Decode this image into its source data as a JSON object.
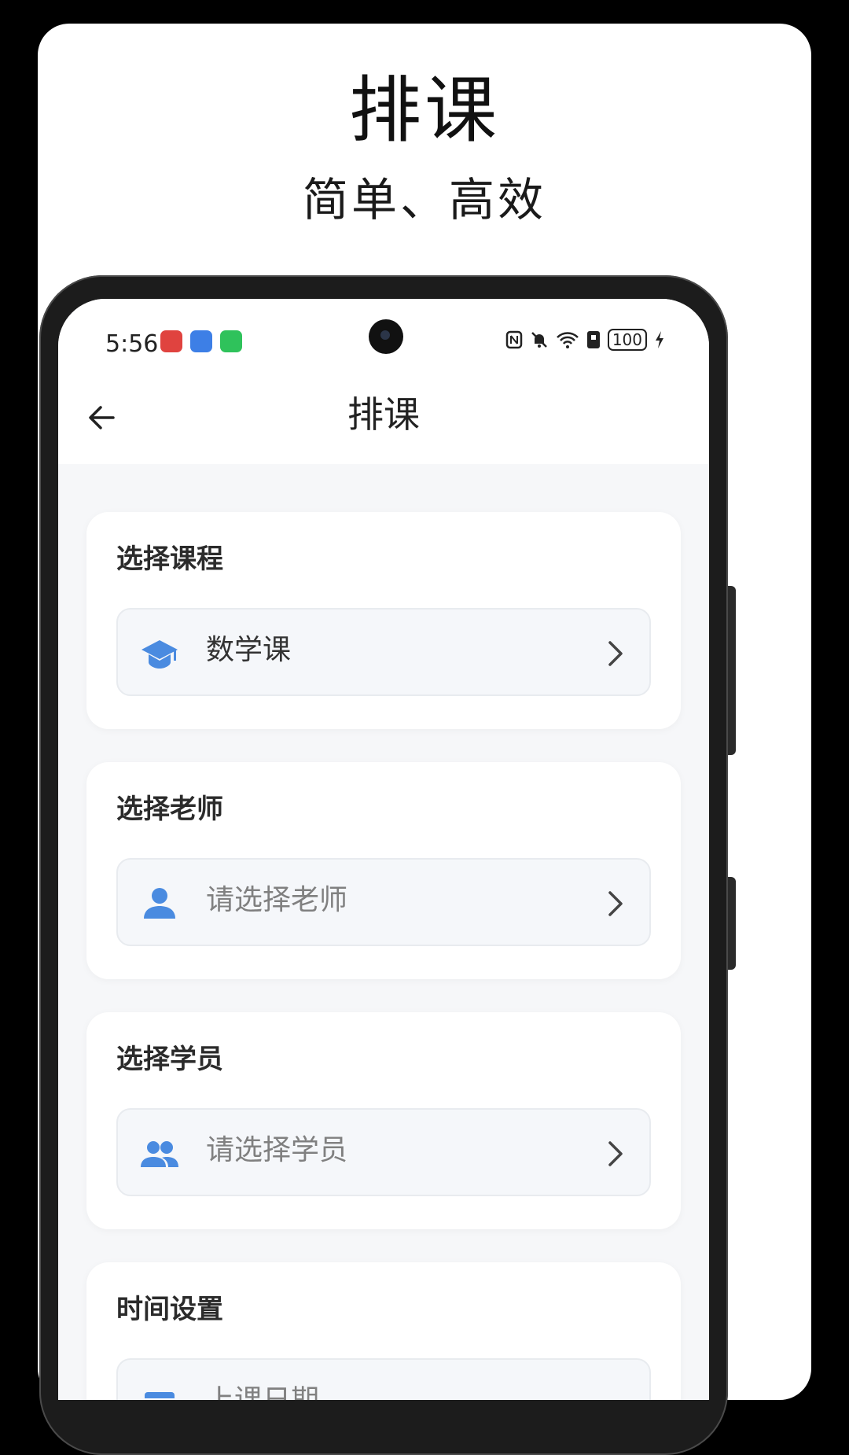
{
  "promo": {
    "title": "排课",
    "subtitle": "简单、高效"
  },
  "status_bar": {
    "time": "5:56",
    "battery": "100",
    "app_icons": [
      "red-app-icon",
      "blue-app-icon",
      "wechat-icon"
    ],
    "right_icons": [
      "nfc-icon",
      "mute-icon",
      "wifi-icon",
      "sim-icon",
      "battery-icon",
      "charging-icon"
    ]
  },
  "app_bar": {
    "title": "排课"
  },
  "sections": [
    {
      "title": "选择课程",
      "value": "数学课",
      "icon": "graduation-cap-icon",
      "is_placeholder": false
    },
    {
      "title": "选择老师",
      "value": "请选择老师",
      "icon": "person-icon",
      "is_placeholder": true
    },
    {
      "title": "选择学员",
      "value": "请选择学员",
      "icon": "people-icon",
      "is_placeholder": true
    },
    {
      "title": "时间设置",
      "value": "上课日期",
      "icon": "calendar-icon",
      "is_placeholder": true
    }
  ],
  "colors": {
    "accent": "#4a8be0",
    "background": "#f6f7f9"
  }
}
